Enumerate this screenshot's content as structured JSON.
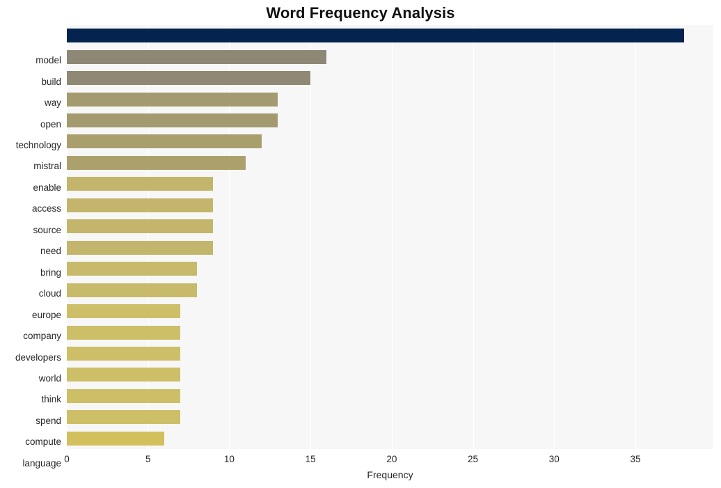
{
  "chart_data": {
    "type": "bar",
    "orientation": "horizontal",
    "title": "Word Frequency Analysis",
    "xlabel": "Frequency",
    "ylabel": "",
    "xlim": [
      0,
      39.8
    ],
    "ylim": [
      0,
      20
    ],
    "grid": true,
    "legend": false,
    "xticks": [
      "0",
      "5",
      "10",
      "15",
      "20",
      "25",
      "30",
      "35"
    ],
    "xtick_values": [
      0,
      5,
      10,
      15,
      20,
      25,
      30,
      35
    ],
    "categories": [
      "model",
      "build",
      "way",
      "open",
      "technology",
      "mistral",
      "enable",
      "access",
      "source",
      "need",
      "bring",
      "cloud",
      "europe",
      "company",
      "developers",
      "world",
      "think",
      "spend",
      "compute",
      "language"
    ],
    "values": [
      38,
      16,
      15,
      13,
      13,
      12,
      11,
      9,
      9,
      9,
      9,
      8,
      8,
      7,
      7,
      7,
      7,
      7,
      7,
      6
    ],
    "bar_colors": [
      "#04234f",
      "#8d8775",
      "#8e8874",
      "#a39a6f",
      "#a39a6f",
      "#a99f6d",
      "#ac a16d",
      "#c3b66c",
      "#c3b66c",
      "#c3b66c",
      "#c3b66c",
      "#c7ba6b",
      "#c7ba6b",
      "#cdbf67",
      "#cdbf67",
      "#cdbf67",
      "#cdbf67",
      "#cdbf67",
      "#cdbf67",
      "#d2c05d"
    ],
    "plot_background": "#f7f7f7",
    "gridline_color": "#ffffff",
    "figure_background": "#ffffff"
  }
}
